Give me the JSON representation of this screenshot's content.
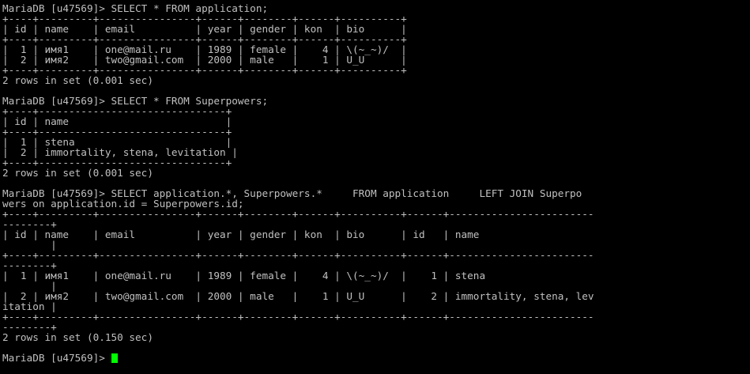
{
  "terminal": {
    "colors": {
      "background": "#000000",
      "text": "#c0c0c0",
      "cursor": "#00ff00"
    },
    "lines": [
      "MariaDB [u47569]> SELECT * FROM application;",
      "+----+---------+----------------+------+--------+------+----------+",
      "| id | name    | email          | year | gender | kon  | bio      |",
      "+----+---------+----------------+------+--------+------+----------+",
      "|  1 | имя1    | one@mail.ru    | 1989 | female |    4 | \\(~_~)/  |",
      "|  2 | имя2    | two@gmail.com  | 2000 | male   |    1 | U_U      |",
      "+----+---------+----------------+------+--------+------+----------+",
      "2 rows in set (0.001 sec)",
      "",
      "MariaDB [u47569]> SELECT * FROM Superpowers;",
      "+----+-------------------------------+",
      "| id | name                          |",
      "+----+-------------------------------+",
      "|  1 | stena                         |",
      "|  2 | immortality, stena, levitation |",
      "+----+-------------------------------+",
      "2 rows in set (0.001 sec)",
      "",
      "MariaDB [u47569]> SELECT application.*, Superpowers.*     FROM application     LEFT JOIN Superpo",
      "wers on application.id = Superpowers.id;",
      "+----+---------+----------------+------+--------+------+----------+------+------------------------",
      "--------+",
      "| id | name    | email          | year | gender | kon  | bio      | id   | name",
      "        |",
      "+----+---------+----------------+------+--------+------+----------+------+------------------------",
      "--------+",
      "|  1 | имя1    | one@mail.ru    | 1989 | female |    4 | \\(~_~)/  |    1 | stena",
      "        |",
      "|  2 | имя2    | two@gmail.com  | 2000 | male   |    1 | U_U      |    2 | immortality, stena, lev",
      "itation |",
      "+----+---------+----------------+------+--------+------+----------+------+------------------------",
      "--------+",
      "2 rows in set (0.150 sec)",
      "",
      "MariaDB [u47569]> "
    ]
  }
}
